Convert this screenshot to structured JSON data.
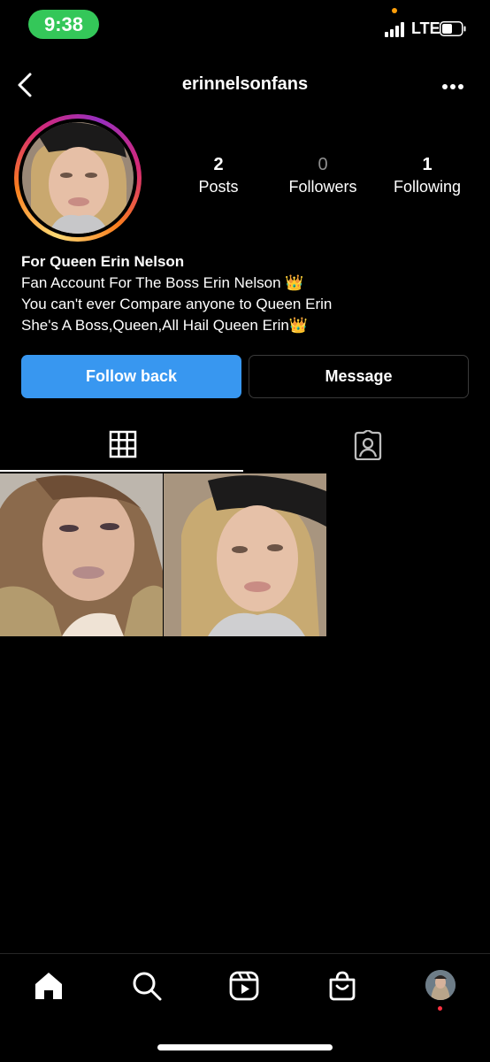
{
  "status_bar": {
    "time": "9:38",
    "network": "LTE",
    "time_pill_color": "#34c759"
  },
  "header": {
    "username": "erinnelsonfans",
    "back_icon": "chevron-left-icon",
    "more_icon": "more-horizontal-icon"
  },
  "profile": {
    "stats": [
      {
        "value": "2",
        "label": "Posts"
      },
      {
        "value": "0",
        "label": "Followers"
      },
      {
        "value": "1",
        "label": "Following"
      }
    ],
    "bio_name": "For Queen Erin Nelson",
    "bio_lines": [
      "Fan Account For The Boss Erin Nelson 👑",
      "You can't ever Compare anyone to Queen Erin",
      "She's A Boss,Queen,All Hail Queen Erin👑"
    ]
  },
  "actions": {
    "follow_back": "Follow back",
    "message": "Message",
    "follow_color": "#3897f0"
  },
  "tabs": [
    {
      "icon": "grid-icon",
      "active": true
    },
    {
      "icon": "tagged-person-icon",
      "active": false
    }
  ],
  "posts_count_shown": 2,
  "bottom_nav": [
    {
      "icon": "home-icon"
    },
    {
      "icon": "search-icon"
    },
    {
      "icon": "reels-icon"
    },
    {
      "icon": "shop-bag-icon"
    },
    {
      "icon": "profile-avatar"
    }
  ]
}
